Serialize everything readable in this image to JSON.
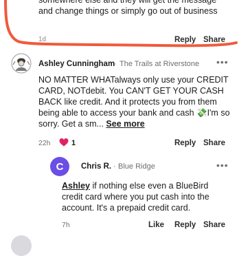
{
  "previous_comment": {
    "text": "somewhere else and they will get the message and change things or simply go out of business",
    "time": "1d",
    "reply_label": "Reply",
    "share_label": "Share"
  },
  "comment": {
    "author": "Ashley Cunningham",
    "separator": "·",
    "location": "The Trails at Riverstone",
    "more_label": "•••",
    "body": "NO MATTER WHATalways only use your CREDIT CARD, NOTdebit. You CAN'T GET YOUR CASH BACK like credit. And it protects you from them being able to access your bank and cash 💸I'm so sorry. Get a sm...",
    "see_more": "See more",
    "time": "22h",
    "reaction_count": "1",
    "reply_label": "Reply",
    "share_label": "Share"
  },
  "reply": {
    "avatar_letter": "C",
    "author": "Chris R.",
    "separator": "·",
    "location": "Blue Ridge",
    "more_label": "•••",
    "mention": "Ashley",
    "body": " if nothing else even a BlueBird credit card where you put cash into the account. It's a prepaid credit card.",
    "time": "7h",
    "like_label": "Like",
    "reply_label": "Reply",
    "share_label": "Share"
  },
  "colors": {
    "highlight": "#f05a3c",
    "avatar_purple": "#6b4ee6",
    "heart_red": "#e0245e"
  },
  "icons": {
    "ashley_avatar": "avatar-illustration-icon",
    "heart": "heart-icon",
    "more": "more-options-icon"
  }
}
